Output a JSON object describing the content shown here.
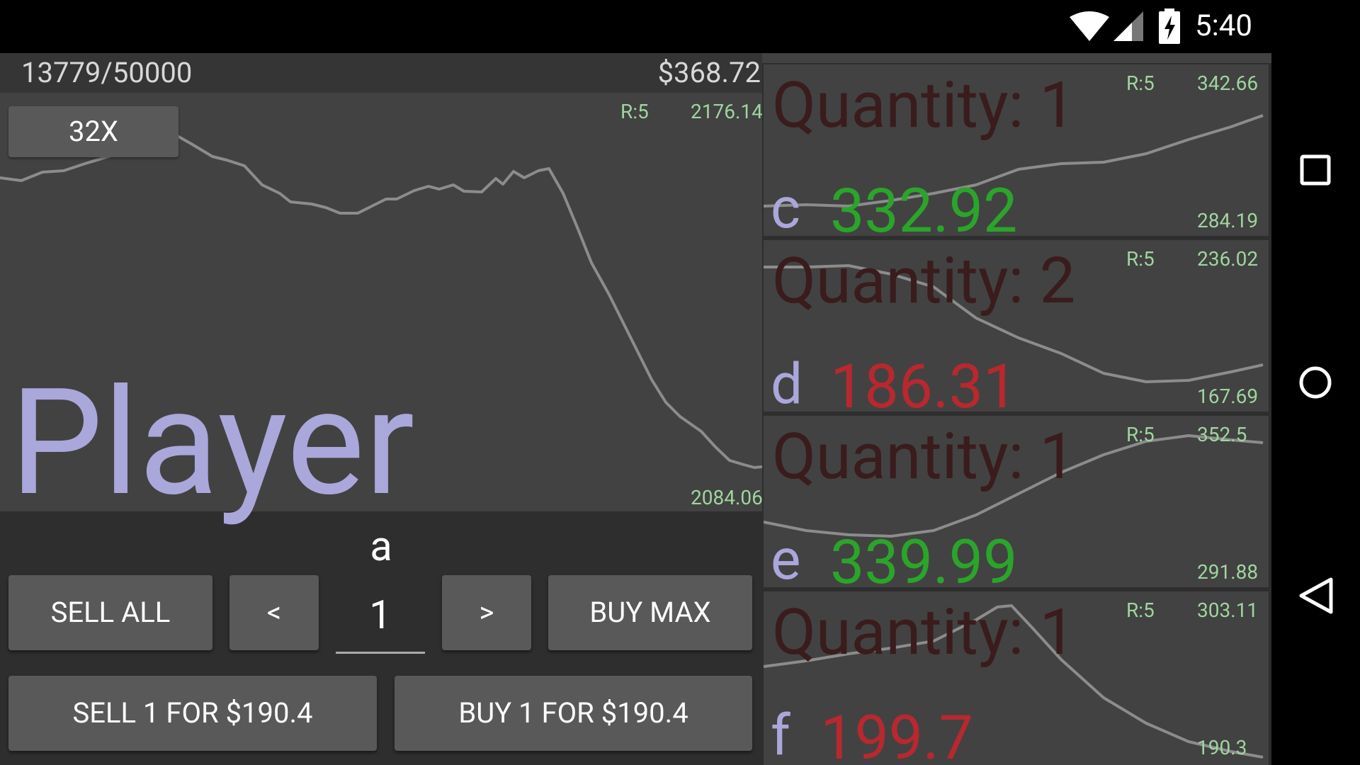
{
  "status_bar": {
    "time": "5:40"
  },
  "header": {
    "progress": "13779/50000",
    "money": "$368.72"
  },
  "main_chart": {
    "r_label": "R:5",
    "max": "2176.14",
    "min": "2084.06",
    "speed": "32X"
  },
  "player_label": "Player",
  "symbol": "a",
  "controls": {
    "sell_all": "SELL ALL",
    "prev": "<",
    "quantity": "1",
    "next": ">",
    "buy_max": "BUY MAX",
    "sell_one": "SELL 1 FOR $190.4",
    "buy_one": "BUY 1 FOR $190.4"
  },
  "stocks": [
    {
      "quantity": "Quantity: 1",
      "symbol": "c",
      "price": "332.92",
      "r_label": "R:5",
      "max": "342.66",
      "min": "284.19",
      "price_color": "#2aa52a"
    },
    {
      "quantity": "Quantity: 2",
      "symbol": "d",
      "price": "186.31",
      "r_label": "R:5",
      "max": "236.02",
      "min": "167.69",
      "price_color": "#b8282e"
    },
    {
      "quantity": "Quantity: 1",
      "symbol": "e",
      "price": "339.99",
      "r_label": "R:5",
      "max": "352.5",
      "min": "291.88",
      "price_color": "#2aa52a"
    },
    {
      "quantity": "Quantity: 1",
      "symbol": "f",
      "price": "199.7",
      "r_label": "R:5",
      "max": "303.11",
      "min": "190.3",
      "price_color": "#b8282e"
    }
  ],
  "colors": {
    "background": "#2e2e2e",
    "panel": "#424242",
    "button": "#595959",
    "up": "#2aa52a",
    "down": "#b8282e",
    "accent": "#aaa7db",
    "range_label": "#9fd59f"
  },
  "icons": [
    "wifi-icon",
    "signal-icon",
    "battery-charging-icon",
    "recents-icon",
    "home-icon",
    "back-icon"
  ]
}
